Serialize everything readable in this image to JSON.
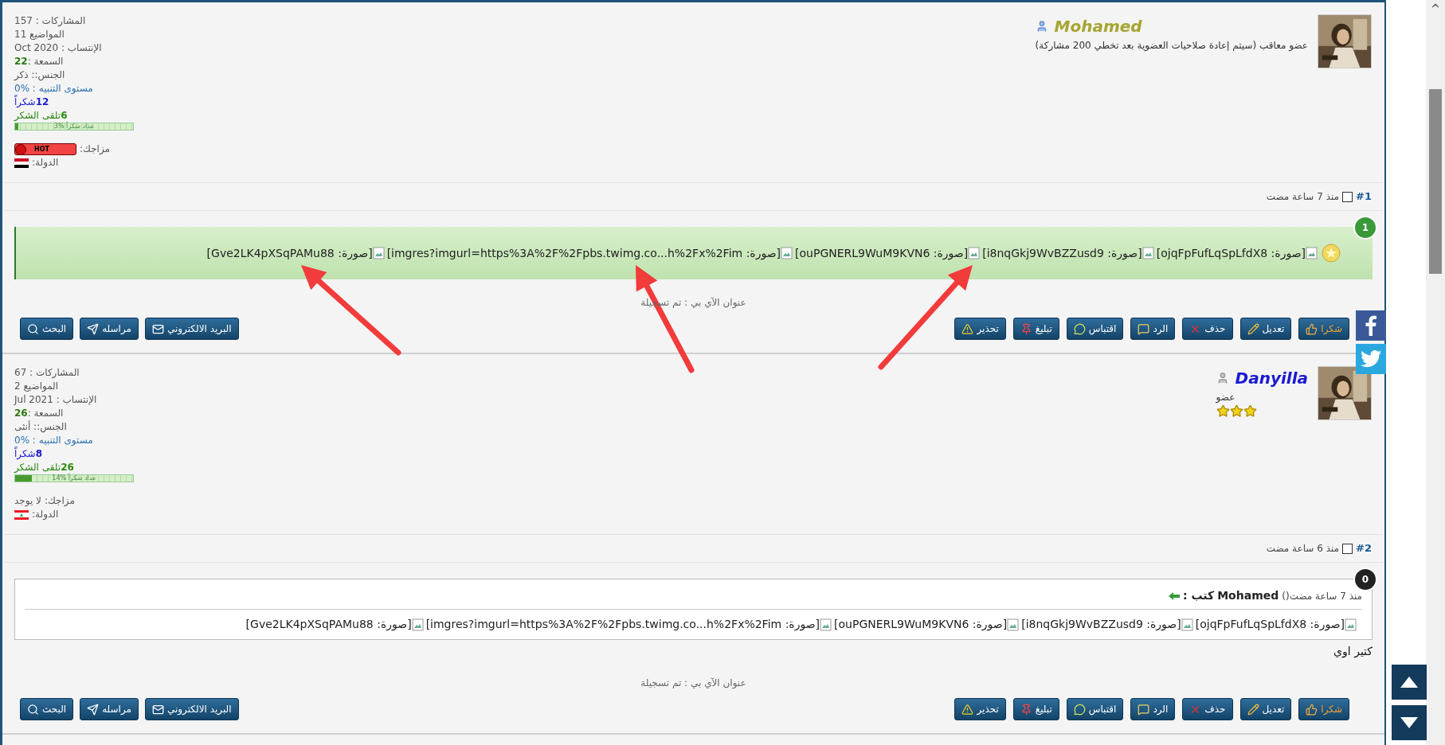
{
  "posts": [
    {
      "number": "#1",
      "time": "منذ 7 ساعة مضت",
      "checked": false,
      "badge": {
        "text": "1",
        "color": "#3a9a3a"
      },
      "user": {
        "name": "Mohamed",
        "color": "#a5a532",
        "online": true,
        "rank": "عضو معاقب (سيتم إعادة صلاحيات العضوية بعد تخطي 200 مشاركة)",
        "stats": [
          "المشاركات : 157",
          "المواضيع 11",
          "الإنتساب : Oct 2020"
        ],
        "reputation": {
          "label": "السمعة : ",
          "value": "22"
        },
        "gender": "الجنس:: ذكر",
        "warning": "مستوى التنبيه : %0",
        "thanks_given": {
          "count": "12",
          "label": "شكراً"
        },
        "thanks_received": {
          "count": "6",
          "label": "تلقى الشكر"
        },
        "thanks_meter": {
          "level": 0.03,
          "label": "عداد شكراً %3"
        },
        "mood": {
          "label": "مزاجك:",
          "kind": "badge",
          "value": "HOT"
        },
        "country": {
          "label": "الدولة:",
          "kind": "egypt"
        }
      },
      "body": {
        "kind": "images",
        "images": [
          "[صورة: ojqFpFufLqSpLfdX8]",
          "[صورة: i8nqGkj9WvBZZusd9]",
          "[صورة: ouPGNERL9WuM9KVN6]",
          "[صورة: imgres?imgurl=https%3A%2F%2Fpbs.twimg.co...h%2Fx%2Fim]",
          "[صورة: Gve2LK4pXSqPAMu88]"
        ]
      },
      "ip": "عنوان الآي بي : تم تسجيلة",
      "actions": [
        {
          "label": "شكرا",
          "kind": "thanks"
        },
        {
          "label": "تعديل",
          "kind": "edit"
        },
        {
          "label": "حذف",
          "kind": "delete"
        },
        {
          "label": "الرد",
          "kind": "reply"
        },
        {
          "label": "اقتباس",
          "kind": "quote"
        },
        {
          "label": "تبليغ",
          "kind": "report"
        },
        {
          "label": "تحذير",
          "kind": "warn"
        }
      ],
      "tools": [
        {
          "label": "البريد الالكتروني",
          "kind": "email"
        },
        {
          "label": "مراسله",
          "kind": "message"
        },
        {
          "label": "البحث",
          "kind": "search"
        }
      ]
    },
    {
      "number": "#2",
      "time": "منذ 6 ساعة مضت",
      "checked": false,
      "badge": {
        "text": "0",
        "color": "#222222"
      },
      "user": {
        "name": "Danyilla",
        "color": "#1a1ad2",
        "online": false,
        "rank": "عضو",
        "stars": 3,
        "stats": [
          "المشاركات : 67",
          "المواضيع 2",
          "الإنتساب : Jul 2021"
        ],
        "reputation": {
          "label": "السمعة : ",
          "value": "26"
        },
        "gender": "الجنس:: أنثى",
        "warning": "مستوى التنبيه : %0",
        "thanks_given": {
          "count": "8",
          "label": "شكراً"
        },
        "thanks_received": {
          "count": "26",
          "label": "تلقى الشكر"
        },
        "thanks_meter": {
          "level": 0.14,
          "label": "عداد شكراً %14"
        },
        "mood": {
          "label": "مزاجك:",
          "kind": "text",
          "value": "لا يوجد"
        },
        "country": {
          "label": "الدولة:",
          "kind": "lebanon"
        }
      },
      "body": {
        "kind": "quote",
        "quote_time": "منذ 7 ساعة مضت()",
        "quote_author": "Mohamed",
        "quote_verb": "كتب :",
        "images": [
          "[صورة: ojqFpFufLqSpLfdX8]",
          "[صورة: i8nqGkj9WvBZZusd9]",
          "[صورة: ouPGNERL9WuM9KVN6]",
          "[صورة: imgres?imgurl=https%3A%2F%2Fpbs.twimg.co...h%2Fx%2Fim]",
          "[صورة: Gve2LK4pXSqPAMu88]"
        ],
        "message": "كتير اوي"
      },
      "ip": "عنوان الآي بي : تم تسجيلة",
      "actions": [
        {
          "label": "شكرا",
          "kind": "thanks"
        },
        {
          "label": "تعديل",
          "kind": "edit"
        },
        {
          "label": "حذف",
          "kind": "delete"
        },
        {
          "label": "الرد",
          "kind": "reply"
        },
        {
          "label": "اقتباس",
          "kind": "quote"
        },
        {
          "label": "تبليغ",
          "kind": "report"
        },
        {
          "label": "تحذير",
          "kind": "warn"
        }
      ],
      "tools": [
        {
          "label": "البريد الالكتروني",
          "kind": "email"
        },
        {
          "label": "مراسله",
          "kind": "message"
        },
        {
          "label": "البحث",
          "kind": "search"
        }
      ]
    }
  ]
}
